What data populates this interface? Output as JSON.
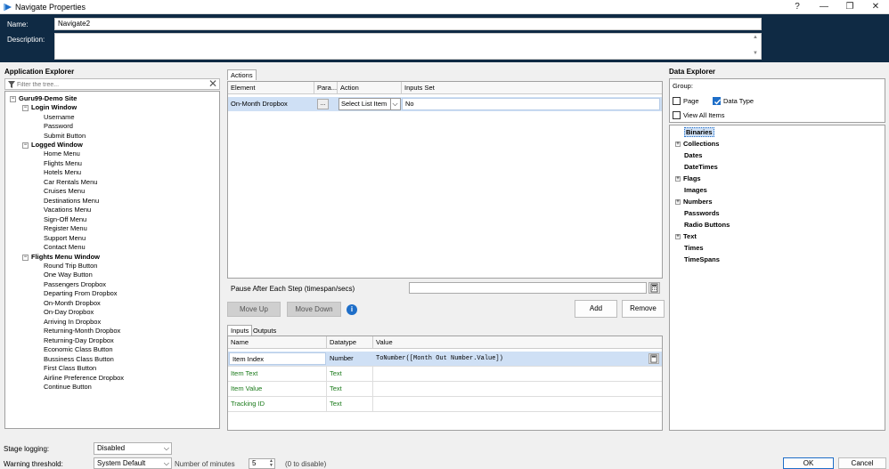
{
  "window": {
    "title": "Navigate Properties",
    "help": "?",
    "minimize": "—",
    "maximize": "❐",
    "close": "✕"
  },
  "header": {
    "name_label": "Name:",
    "name_value": "Navigate2",
    "description_label": "Description:",
    "description_value": ""
  },
  "app_explorer": {
    "title": "Application Explorer",
    "filter_placeholder": "Filter the tree...",
    "root": "Guru99-Demo Site",
    "groups": [
      {
        "label": "Login Window",
        "items": [
          "Username",
          "Password",
          "Submit Button"
        ]
      },
      {
        "label": "Logged Window",
        "items": [
          "Home Menu",
          "Flights Menu",
          "Hotels Menu",
          "Car Rentals Menu",
          "Cruises Menu",
          "Destinations Menu",
          "Vacations Menu",
          "Sign-Off Menu",
          "Register Menu",
          "Support Menu",
          "Contact Menu"
        ]
      },
      {
        "label": "Flights Menu Window",
        "items": [
          "Round Trip Button",
          "One Way Button",
          "Passengers Dropbox",
          "Departing From Dropbox",
          "On-Month Dropbox",
          "On-Day Dropbox",
          "Arriving In Dropbox",
          "Returning-Month Dropbox",
          "Returning-Day Dropbox",
          "Economic Class Button",
          "Bussiness Class Button",
          "First Class Button",
          "Airline Preference Dropbox",
          "Continue Button"
        ]
      }
    ]
  },
  "actions": {
    "tab": "Actions",
    "columns": [
      "Element",
      "Para...",
      "Action",
      "Inputs Set"
    ],
    "row": {
      "element": "On-Month Dropbox",
      "params": "...",
      "action": "Select List Item",
      "inputs_set": "No"
    },
    "pause_label": "Pause After Each Step (timespan/secs)",
    "move_up": "Move Up",
    "move_down": "Move Down",
    "add": "Add",
    "remove": "Remove"
  },
  "inputs": {
    "tabs": [
      "Inputs",
      "Outputs"
    ],
    "columns": [
      "Name",
      "Datatype",
      "Value"
    ],
    "rows": [
      {
        "name": "Item Index",
        "datatype": "Number",
        "value": "ToNumber([Month Out Number.Value])"
      },
      {
        "name": "Item Text",
        "datatype": "Text",
        "value": ""
      },
      {
        "name": "Item Value",
        "datatype": "Text",
        "value": ""
      },
      {
        "name": "Tracking ID",
        "datatype": "Text",
        "value": ""
      }
    ]
  },
  "data_explorer": {
    "title": "Data Explorer",
    "group_label": "Group:",
    "page_label": "Page",
    "page_checked": false,
    "datatype_label": "Data Type",
    "datatype_checked": true,
    "view_all_label": "View All Items",
    "view_all_checked": false,
    "items": [
      {
        "label": "Binaries",
        "expandable": false,
        "selected": true
      },
      {
        "label": "Collections",
        "expandable": true
      },
      {
        "label": "Dates",
        "expandable": false
      },
      {
        "label": "DateTimes",
        "expandable": false
      },
      {
        "label": "Flags",
        "expandable": true
      },
      {
        "label": "Images",
        "expandable": false
      },
      {
        "label": "Numbers",
        "expandable": true
      },
      {
        "label": "Passwords",
        "expandable": false
      },
      {
        "label": "Radio Buttons",
        "expandable": false
      },
      {
        "label": "Text",
        "expandable": true
      },
      {
        "label": "Times",
        "expandable": false
      },
      {
        "label": "TimeSpans",
        "expandable": false
      }
    ]
  },
  "footer": {
    "stage_logging_label": "Stage logging:",
    "stage_logging_value": "Disabled",
    "warning_label": "Warning threshold:",
    "warning_value": "System Default",
    "minutes_label": "Number of minutes",
    "minutes_value": "5",
    "disable_hint": "(0 to disable)",
    "ok": "OK",
    "cancel": "Cancel"
  },
  "colors": {
    "header_bg": "#0f2a44",
    "selection": "#cfe0f5",
    "highlight": "#1e6ec8",
    "green_text": "#1a7a1a"
  }
}
